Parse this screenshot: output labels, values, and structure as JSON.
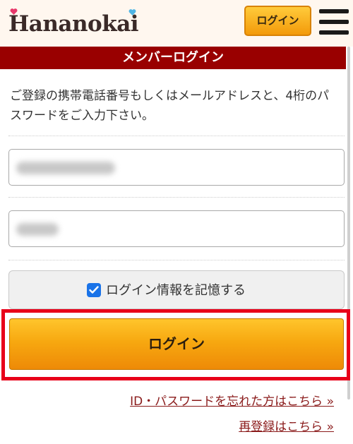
{
  "header": {
    "logo_text": "Hananokai",
    "login_label": "ログイン",
    "colors": {
      "heart_pink": "#e8376a",
      "heart_blue": "#4fb5e5",
      "accent": "#f39a0a"
    }
  },
  "title_bar": {
    "label": "メンバーログイン",
    "color": "#990000"
  },
  "form": {
    "instructions": "ご登録の携帯電話番号もしくはメールアドレスと、4桁のパスワードをご入力下さい。",
    "remember_label": "ログイン情報を記憶する",
    "remember_checked": true,
    "submit_label": "ログイン"
  },
  "links": {
    "forgot": "ID・パスワードを忘れた方はこちら »",
    "register": "再登録はこちら »"
  }
}
